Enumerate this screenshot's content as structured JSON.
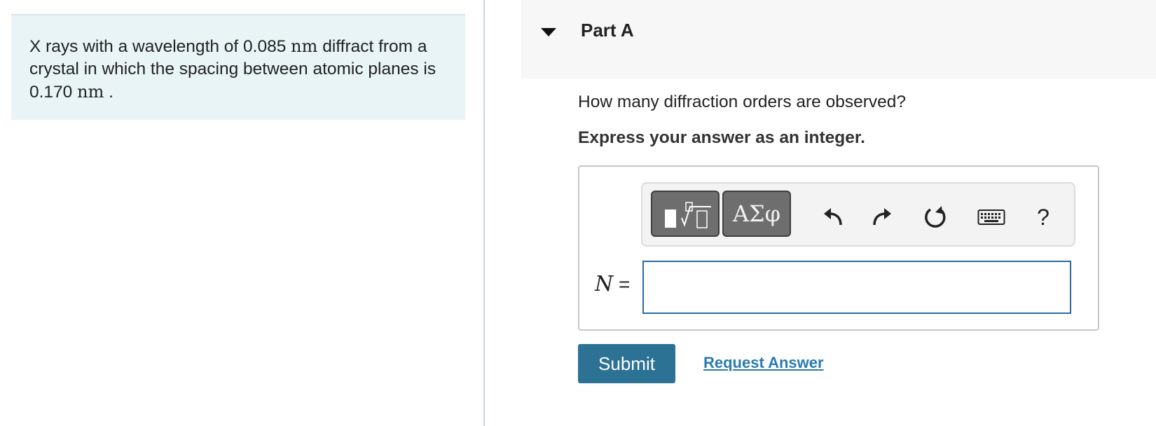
{
  "problem": {
    "text_1": "X rays with a wavelength of 0.085 ",
    "unit_1": "nm",
    "text_2": " diffract from a crystal in which the spacing between atomic planes is 0.170 ",
    "unit_2": "nm",
    "text_3": " ."
  },
  "part": {
    "title": "Part A",
    "question": "How many diffraction orders are observed?",
    "instruction": "Express your answer as an integer."
  },
  "toolbar": {
    "greek_label": "ΑΣφ",
    "help_label": "?",
    "icons": [
      "templates-icon",
      "undo-icon",
      "redo-icon",
      "reset-icon",
      "keyboard-icon",
      "help-icon"
    ]
  },
  "answer": {
    "variable": "N",
    "equals": " =",
    "value": "",
    "placeholder": ""
  },
  "actions": {
    "submit_label": "Submit",
    "request_answer_label": "Request Answer"
  },
  "colors": {
    "problem_bg": "#e8f4f6",
    "submit_bg": "#2c7295",
    "link": "#2a7ab0",
    "input_border": "#2b6aa0"
  }
}
